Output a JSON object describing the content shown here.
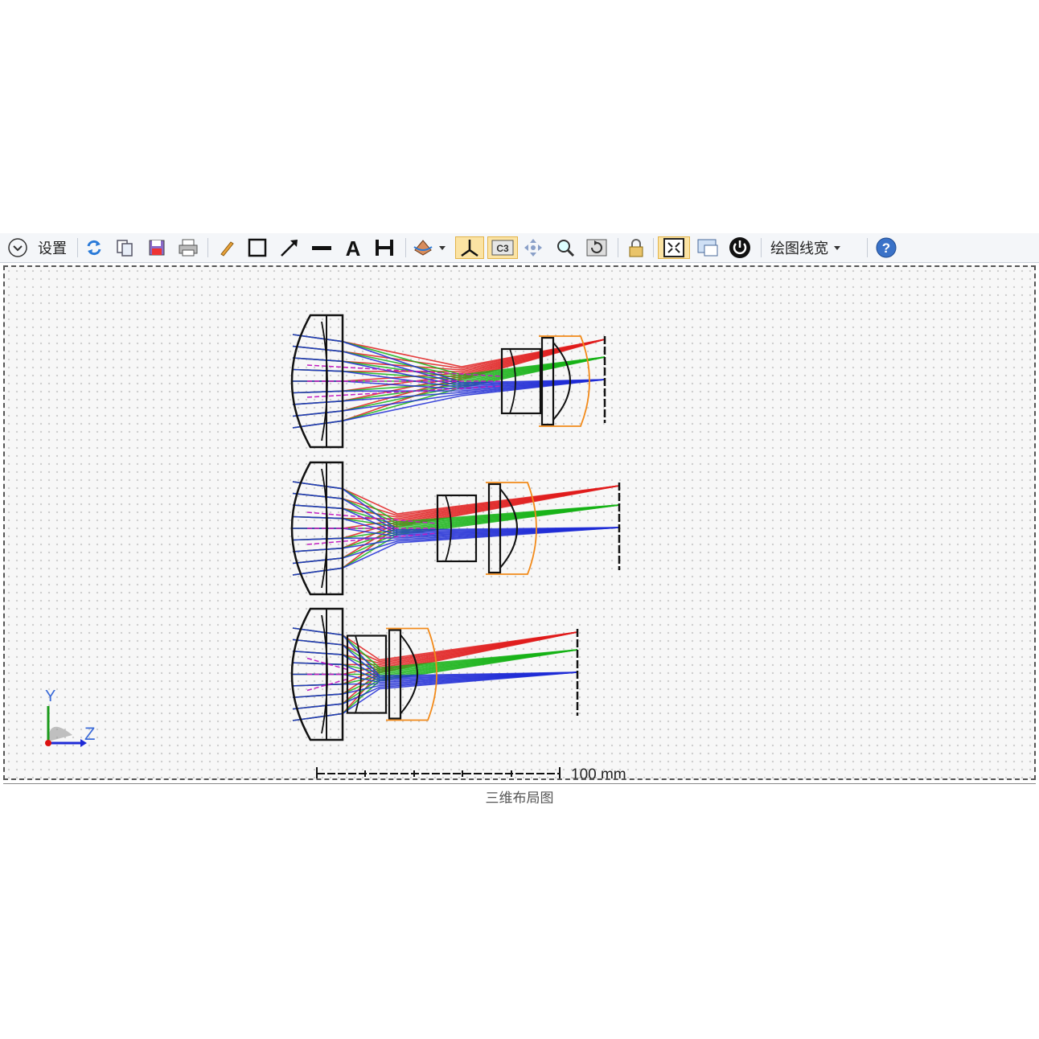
{
  "toolbar": {
    "settings_label": "设置",
    "line_width_label": "绘图线宽",
    "icons": [
      "collapse-icon",
      "refresh-icon",
      "copy-icon",
      "save-icon",
      "print-icon",
      "pencil-icon",
      "rectangle-icon",
      "arrow-icon",
      "line-icon",
      "text-icon",
      "dimension-icon",
      "rotate-view-icon",
      "axis-icon",
      "lens-layout-icon",
      "move-icon",
      "zoom-icon",
      "reset-view-icon",
      "lock-icon",
      "fit-icon",
      "window-icon",
      "power-icon",
      "help-icon"
    ]
  },
  "plot": {
    "scale_label": "100 mm",
    "axis_y_label": "Y",
    "axis_z_label": "Z",
    "ray_colors": [
      "#1f2bd6",
      "#16b316",
      "#e01c1c",
      "#c21fc2"
    ],
    "lens_color": "#111111",
    "orange_lens_color": "#f28a1a"
  },
  "status": {
    "window_title": "三维布局图"
  }
}
